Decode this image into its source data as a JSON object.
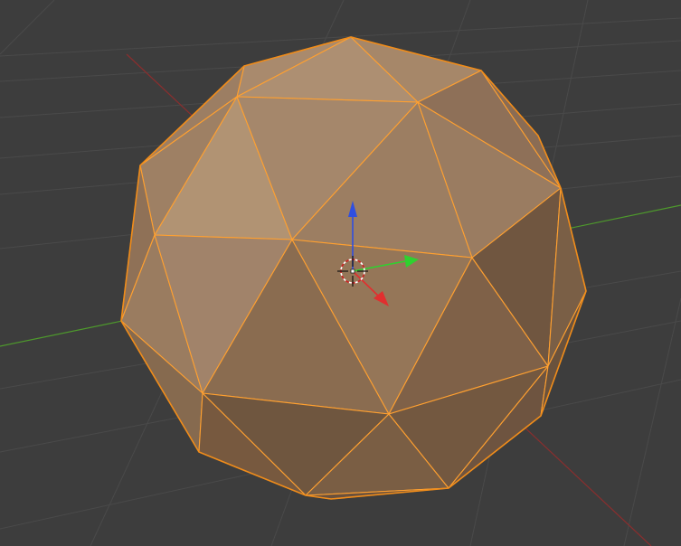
{
  "viewport": {
    "background_color": "#3d3d3d",
    "grid_color": "#4a4a4a",
    "grid_visible": true
  },
  "axes": {
    "x_axis_color": "#8a2e2e",
    "y_axis_color": "#4e9a2c"
  },
  "object": {
    "type": "icosphere",
    "selected": true,
    "edge_color": "#ffa030",
    "outline_color": "#f08c1a"
  },
  "gizmo": {
    "x_axis_color": "#e12f2f",
    "y_axis_color": "#2fd12f",
    "z_axis_color": "#2f4fe1",
    "cursor_icon": "3d-cursor-icon"
  }
}
